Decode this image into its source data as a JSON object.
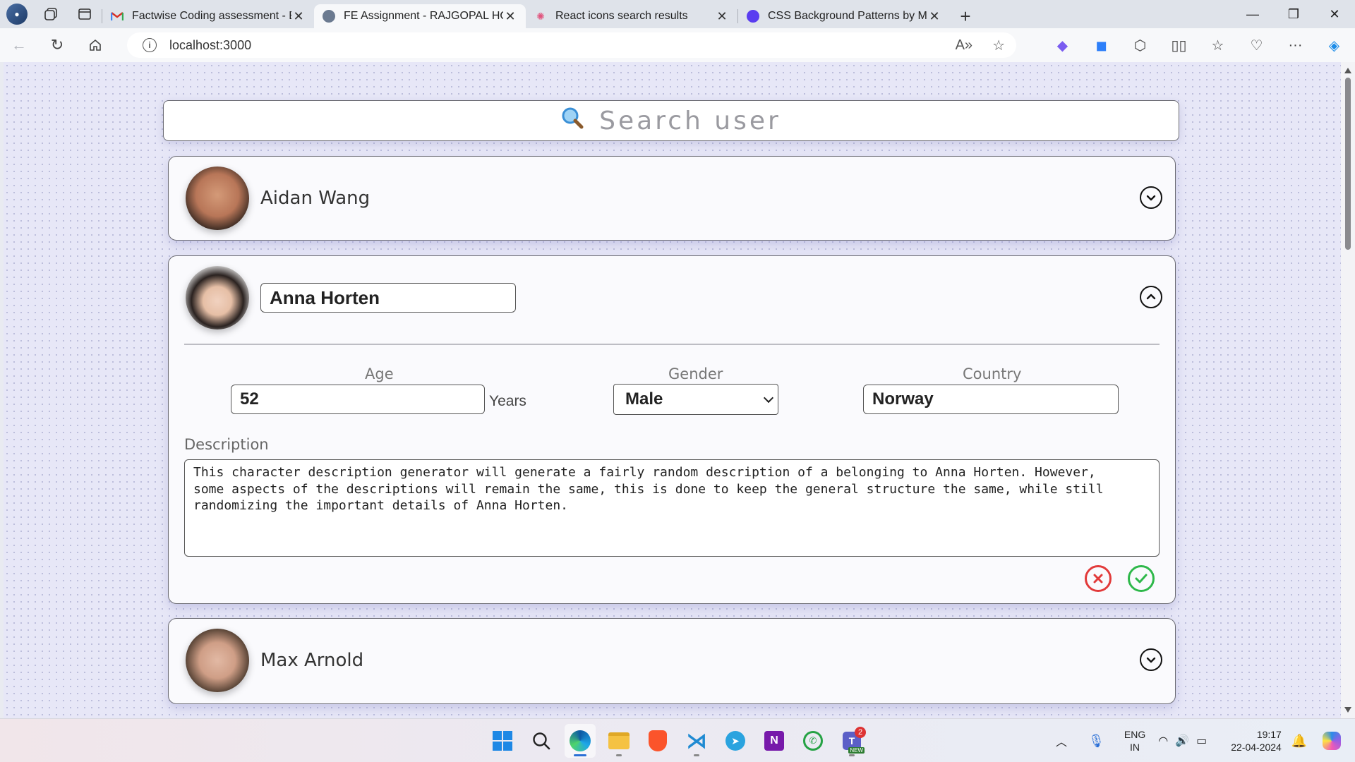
{
  "browser": {
    "tabs": [
      {
        "title": "Factwise Coding assessment - Ba",
        "icon": "gmail-icon",
        "active": false
      },
      {
        "title": "FE Assignment - RAJGOPAL HOT/",
        "icon": "profile-icon",
        "active": true
      },
      {
        "title": "React icons search results",
        "icon": "react-icon",
        "active": false
      },
      {
        "title": "CSS Background Patterns by Ma",
        "icon": "magic-pattern-icon",
        "active": false
      }
    ],
    "url": "localhost:3000"
  },
  "search": {
    "placeholder": "Search user"
  },
  "users": [
    {
      "name": "Aidan Wang",
      "expanded": false
    },
    {
      "name": "Anna Horten",
      "expanded": true,
      "age_label": "Age",
      "age": "52",
      "age_unit": "Years",
      "gender_label": "Gender",
      "gender": "Male",
      "country_label": "Country",
      "country": "Norway",
      "description_label": "Description",
      "description": "This character description generator will generate a fairly random description of a belonging to Anna Horten. However,\nsome aspects of the descriptions will remain the same, this is done to keep the general structure the same, while still\nrandomizing the important details of Anna Horten."
    },
    {
      "name": "Max Arnold",
      "expanded": false
    }
  ],
  "taskbar": {
    "language": "ENG",
    "region": "IN",
    "time": "19:17",
    "date": "22-04-2024",
    "teams_badge": "2",
    "teams_tag": "NEW"
  },
  "colors": {
    "cancel": "#e23a3a",
    "save": "#2eb84a",
    "page_bg": "#e7e7f7"
  }
}
